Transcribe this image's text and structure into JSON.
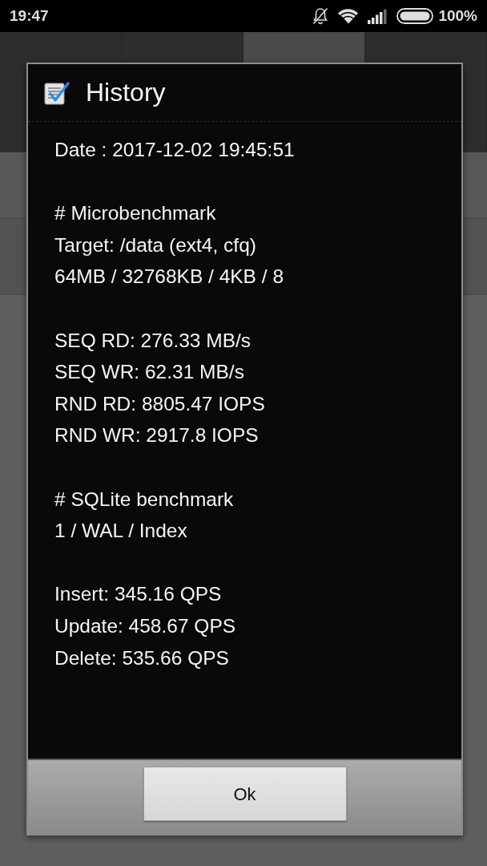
{
  "status_bar": {
    "time": "19:47",
    "battery": "100%"
  },
  "app": {
    "tabs": [
      {
        "selected": false
      },
      {
        "selected": false
      },
      {
        "selected": true
      },
      {
        "selected": false
      }
    ]
  },
  "dialog": {
    "title": "History",
    "sections": [
      [
        "Date : 2017-12-02 19:45:51"
      ],
      [
        "# Microbenchmark",
        "Target: /data (ext4, cfq)",
        "64MB / 32768KB / 4KB / 8"
      ],
      [
        "SEQ RD: 276.33 MB/s",
        "SEQ WR: 62.31 MB/s",
        "RND RD: 8805.47 IOPS",
        "RND WR: 2917.8 IOPS"
      ],
      [
        "# SQLite benchmark",
        "1 / WAL / Index"
      ],
      [
        "Insert: 345.16 QPS",
        "Update: 458.67 QPS",
        "Delete: 535.66 QPS"
      ]
    ],
    "buttons": [
      "Ok"
    ]
  }
}
